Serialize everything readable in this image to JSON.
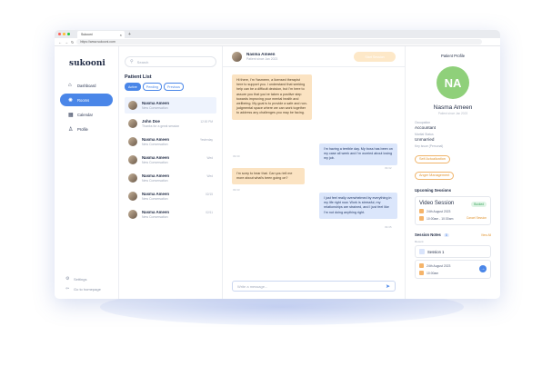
{
  "browser": {
    "tab_title": "Sukooni",
    "url": "https://www.sukooni.com"
  },
  "sidebar": {
    "logo": "sukooni",
    "items": [
      {
        "label": "Dashboard",
        "icon": "home-icon"
      },
      {
        "label": "Rooms",
        "icon": "rooms-icon"
      },
      {
        "label": "Calendar",
        "icon": "calendar-icon"
      },
      {
        "label": "Profile",
        "icon": "user-icon"
      }
    ],
    "bottom": [
      {
        "label": "Settings",
        "icon": "gear-icon"
      },
      {
        "label": "Go to homepage",
        "icon": "logout-icon"
      }
    ]
  },
  "patients": {
    "search_placeholder": "Search",
    "title": "Patient List",
    "filters": [
      "Active",
      "Pending",
      "Previous"
    ],
    "items": [
      {
        "name": "Nasma Ameen",
        "sub": "New Conversation",
        "time": ""
      },
      {
        "name": "John Doe",
        "sub": "Thanks for a great session",
        "time": "12:00 PM"
      },
      {
        "name": "Nasma Ameen",
        "sub": "New Conversation",
        "time": "Yesterday"
      },
      {
        "name": "Nasma Ameen",
        "sub": "New Conversation",
        "time": "Wed"
      },
      {
        "name": "Nasma Ameen",
        "sub": "New Conversation",
        "time": "Wed"
      },
      {
        "name": "Nasma Ameen",
        "sub": "New Conversation",
        "time": "02/15"
      },
      {
        "name": "Nasma Ameen",
        "sub": "New Conversation",
        "time": "02/11"
      }
    ]
  },
  "chat": {
    "name": "Nasma Ameen",
    "status": "Patient since Jan 2023",
    "session_button": "Start Session",
    "messages": [
      {
        "dir": "in",
        "text": "Hi there, I'm Yasmeen, a licensed therapist here to support you. I understand that seeking help can be a difficult decision, but I'm here to assure you that you've taken a positive step towards improving your mental health and wellbeing. My goal is to provide a safe and non-judgmental space where we can work together to address any challenges you may be facing.",
        "time": "09:30"
      },
      {
        "dir": "out",
        "text": "I'm having a terrible day. My boss has been on my case all week and I'm worried about losing my job.",
        "time": "09:32"
      },
      {
        "dir": "in",
        "text": "I'm sorry to hear that. Can you tell me more about what's been going on?",
        "time": "09:33"
      },
      {
        "dir": "out",
        "text": "I just feel really overwhelmed by everything in my life right now. Work is stressful, my relationships are strained, and I just feel like I'm not doing anything right.",
        "time": "09:35"
      }
    ],
    "composer_placeholder": "Write a message..."
  },
  "profile": {
    "title": "Patient Profile",
    "initials": "NA",
    "avatar_color": "#8fd07a",
    "name": "Nasma Ameen",
    "since": "Patient since Jan 2023",
    "occupation_label": "Occupation",
    "occupation": "Accountant",
    "marital_label": "Marital Status",
    "marital": "Unmarried",
    "issue_label": "Key issue (Personal)",
    "issues": [
      "Self Actualization",
      "Anger Management"
    ],
    "upcoming_title": "Upcoming Sessions",
    "session": {
      "title": "Video Session",
      "badge": "Booked",
      "date": "24th August 2023",
      "time": "10:00am - 10:30am",
      "cancel": "Cancel Session"
    },
    "notes_title": "Session Notes",
    "notes_count": "3",
    "view_all": "View All",
    "notes_sub": "Recent",
    "note": {
      "title": "Session 1",
      "date": "24th August 2023",
      "time": "10:00am"
    }
  }
}
